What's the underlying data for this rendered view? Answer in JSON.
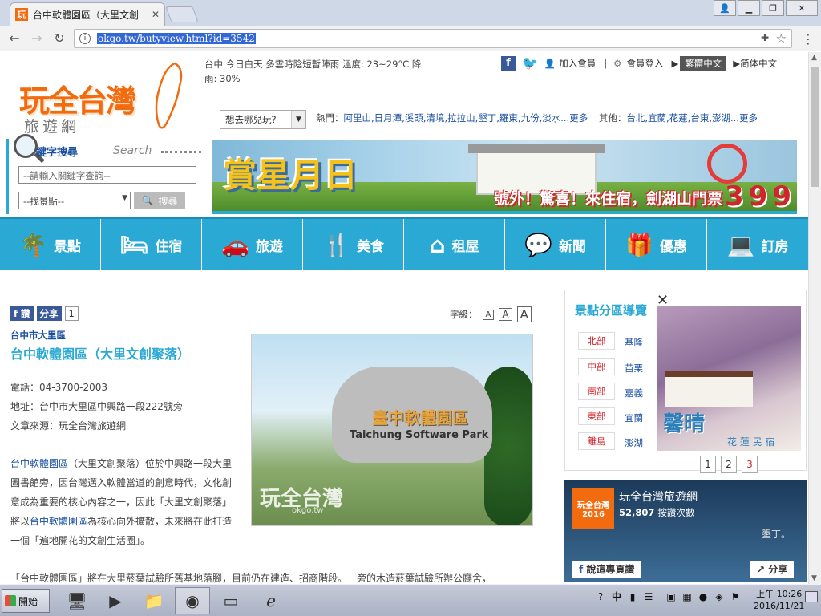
{
  "browser": {
    "tab_title": "台中軟體園區（大里文創",
    "tab_favicon": "玩",
    "url": "okgo.tw/butyview.html?id=3542",
    "window_buttons": [
      "person-icon",
      "minimize-icon",
      "restore-icon",
      "close-icon"
    ]
  },
  "header": {
    "logo_main": "玩全台灣",
    "logo_sub": "旅遊網",
    "weather_line1": "台中 今日白天 多雲時陰短暫陣雨 溫度: 23~29°C 降",
    "weather_line2": "雨: 30%",
    "fb_label": "f",
    "join": "加入會員",
    "login": "會員登入",
    "trad": "繁體中文",
    "simp": "简体中文",
    "where_select": "想去哪兒玩?",
    "hot_label": "熱門：",
    "hot_items": "阿里山,日月潭,溪頭,清境,拉拉山,墾丁,羅東,九份,淡水...更多",
    "other_label": "其他：",
    "other_items": "台北,宜蘭,花蓮,台東,澎湖...更多"
  },
  "search": {
    "title": "鍵字搜尋",
    "title_en": "Search",
    "keyword_placeholder": "--請輸入關鍵字查詢--",
    "spot_select": "--找景點--",
    "button": "搜尋"
  },
  "banner": {
    "slogan": "賞星月日",
    "promo": "號外！驚喜！來住宿，劍湖山門票",
    "price": "399"
  },
  "mainnav": [
    {
      "label": "景點",
      "icon": "palm-tree-icon",
      "glyph": "🌴"
    },
    {
      "label": "住宿",
      "icon": "bed-icon",
      "glyph": "🛏"
    },
    {
      "label": "旅遊",
      "icon": "car-icon",
      "glyph": "🚗"
    },
    {
      "label": "美食",
      "icon": "fork-knife-icon",
      "glyph": "🍴"
    },
    {
      "label": "租屋",
      "icon": "house-icon",
      "glyph": "⌂"
    },
    {
      "label": "新聞",
      "icon": "chat-icon",
      "glyph": "💬"
    },
    {
      "label": "優惠",
      "icon": "gift-icon",
      "glyph": "🎁"
    },
    {
      "label": "訂房",
      "icon": "laptop-icon",
      "glyph": "💻"
    }
  ],
  "article": {
    "fb_like": "f 讚",
    "share": "分享",
    "share_count": "1",
    "font_label": "字級：",
    "font_sizes": [
      "A",
      "A",
      "A"
    ],
    "region": "台中市大里區",
    "title": "台中軟體園區（大里文創聚落）",
    "phone": "電話：04-3700-2003",
    "address": "地址：台中市大里區中興路一段222號旁",
    "source": "文章來源：玩全台灣旅遊網",
    "desc_link1": "台中軟體園區",
    "desc_part1": "（大里文創聚落）位於中興路一段大里圖書館旁，因台灣邁入軟體當道的創意時代，文化創意成為重要的核心內容之一，因此「大里文創聚落」將以",
    "desc_link2": "台中軟體園區",
    "desc_part2": "為核心向外擴散，未來將在此打造一個「遍地開花的文創生活圈」。",
    "desc2": "「台中軟體園區」將在大里菸葉試驗所舊基地落腳，目前仍在建造、招商階段。一旁的木造菸葉試驗所辦公廳舍，",
    "photo_sign": "臺中軟體園區",
    "photo_sign_en": "Taichung Software Park",
    "photo_wm": "玩全台灣",
    "photo_wm2": "okgo.tw"
  },
  "sidebar": {
    "title": "景點分區導覽",
    "regions": [
      {
        "tag": "北部",
        "cities": "基隆"
      },
      {
        "tag": "中部",
        "cities": "苗栗"
      },
      {
        "tag": "南部",
        "cities": "嘉義"
      },
      {
        "tag": "東部",
        "cities": "宜蘭"
      },
      {
        "tag": "離島",
        "cities": "澎湖"
      }
    ],
    "ad_brand": "馨晴",
    "ad_brand2": "花 蓮 民 宿",
    "pages": [
      "1",
      "2",
      "3"
    ],
    "fb_name": "玩全台灣旅遊網",
    "fb_logo": "玩全台灣",
    "fb_year": "2016",
    "fb_count": "52,807",
    "fb_count_label": "按讚次數",
    "fb_like_btn": "說這專頁讚",
    "fb_share_btn": "分享",
    "fb_loc": "墾丁。"
  },
  "taskbar": {
    "start": "開始",
    "ime": "中",
    "time": "上午 10:26",
    "date": "2016/11/21"
  }
}
